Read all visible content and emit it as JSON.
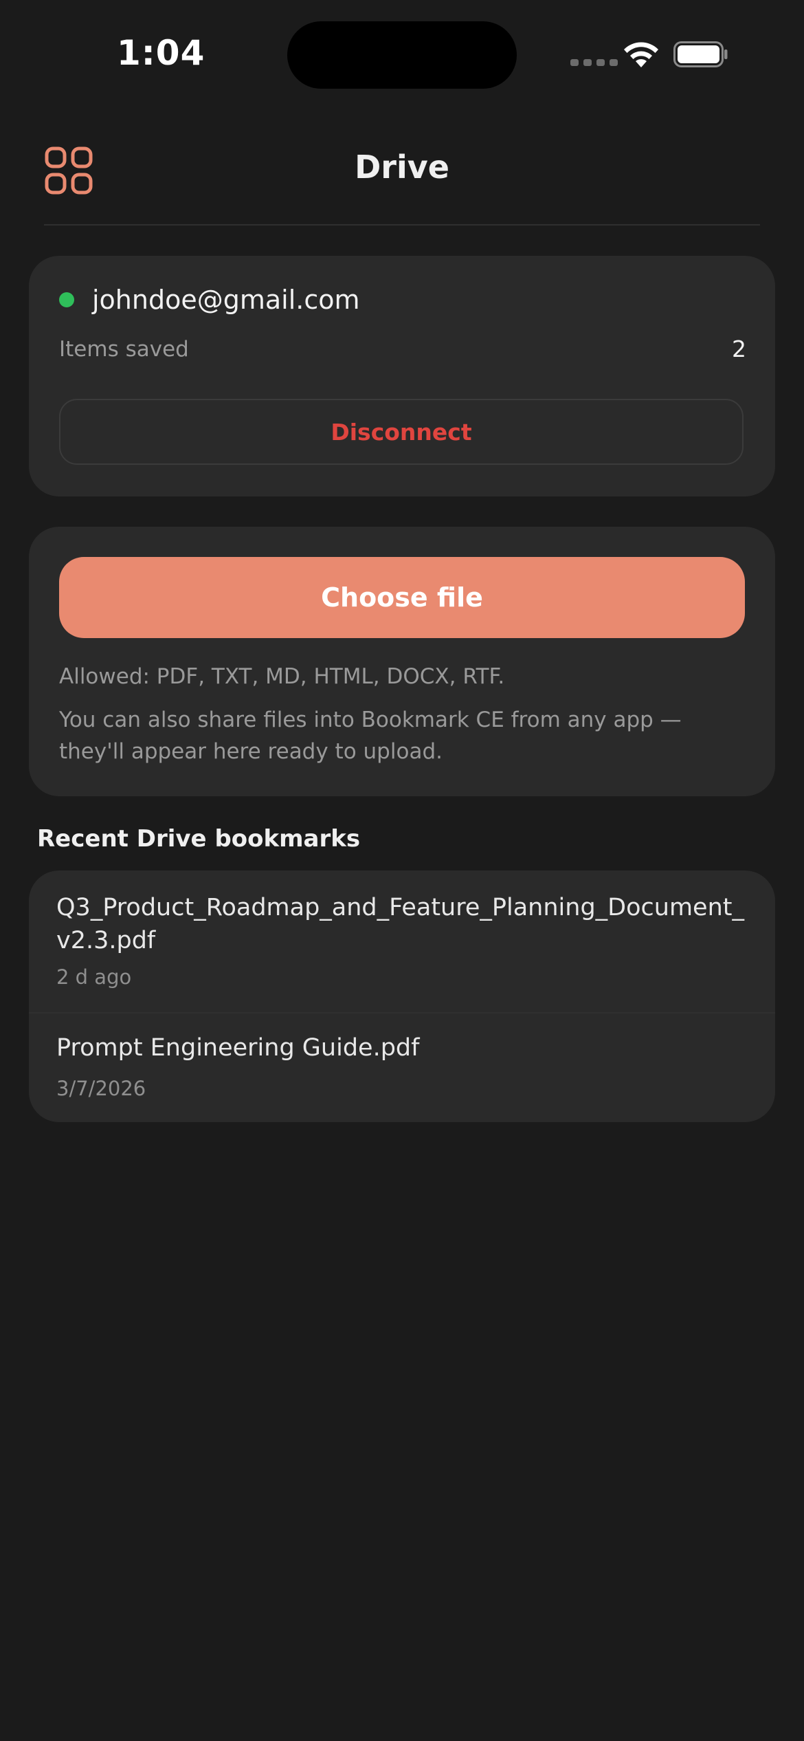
{
  "status_bar": {
    "time": "1:04",
    "icons": [
      "signal-icon",
      "wifi-icon",
      "battery-icon"
    ]
  },
  "header": {
    "title": "Drive",
    "menu_icon": "grid-icon"
  },
  "account": {
    "email": "johndoe@gmail.com",
    "status": "connected",
    "items_saved_label": "Items saved",
    "items_saved_count": "2",
    "disconnect_label": "Disconnect"
  },
  "upload": {
    "choose_file_label": "Choose file",
    "allowed_text": "Allowed: PDF, TXT, MD, HTML, DOCX, RTF.",
    "share_hint": "You can also share files into Bookmark CE from any app — they'll appear here ready to upload."
  },
  "recent": {
    "heading": "Recent Drive bookmarks",
    "items": [
      {
        "name": "Q3_Product_Roadmap_and_Feature_Planning_Document_v2.3.pdf",
        "date": "2 d ago"
      },
      {
        "name": "Prompt Engineering Guide.pdf",
        "date": "3/7/2026"
      }
    ]
  },
  "colors": {
    "background": "#1b1b1b",
    "card": "#2a2a2a",
    "accent": "#e98a70",
    "danger": "#e0453f",
    "connected": "#2fbe5a"
  }
}
